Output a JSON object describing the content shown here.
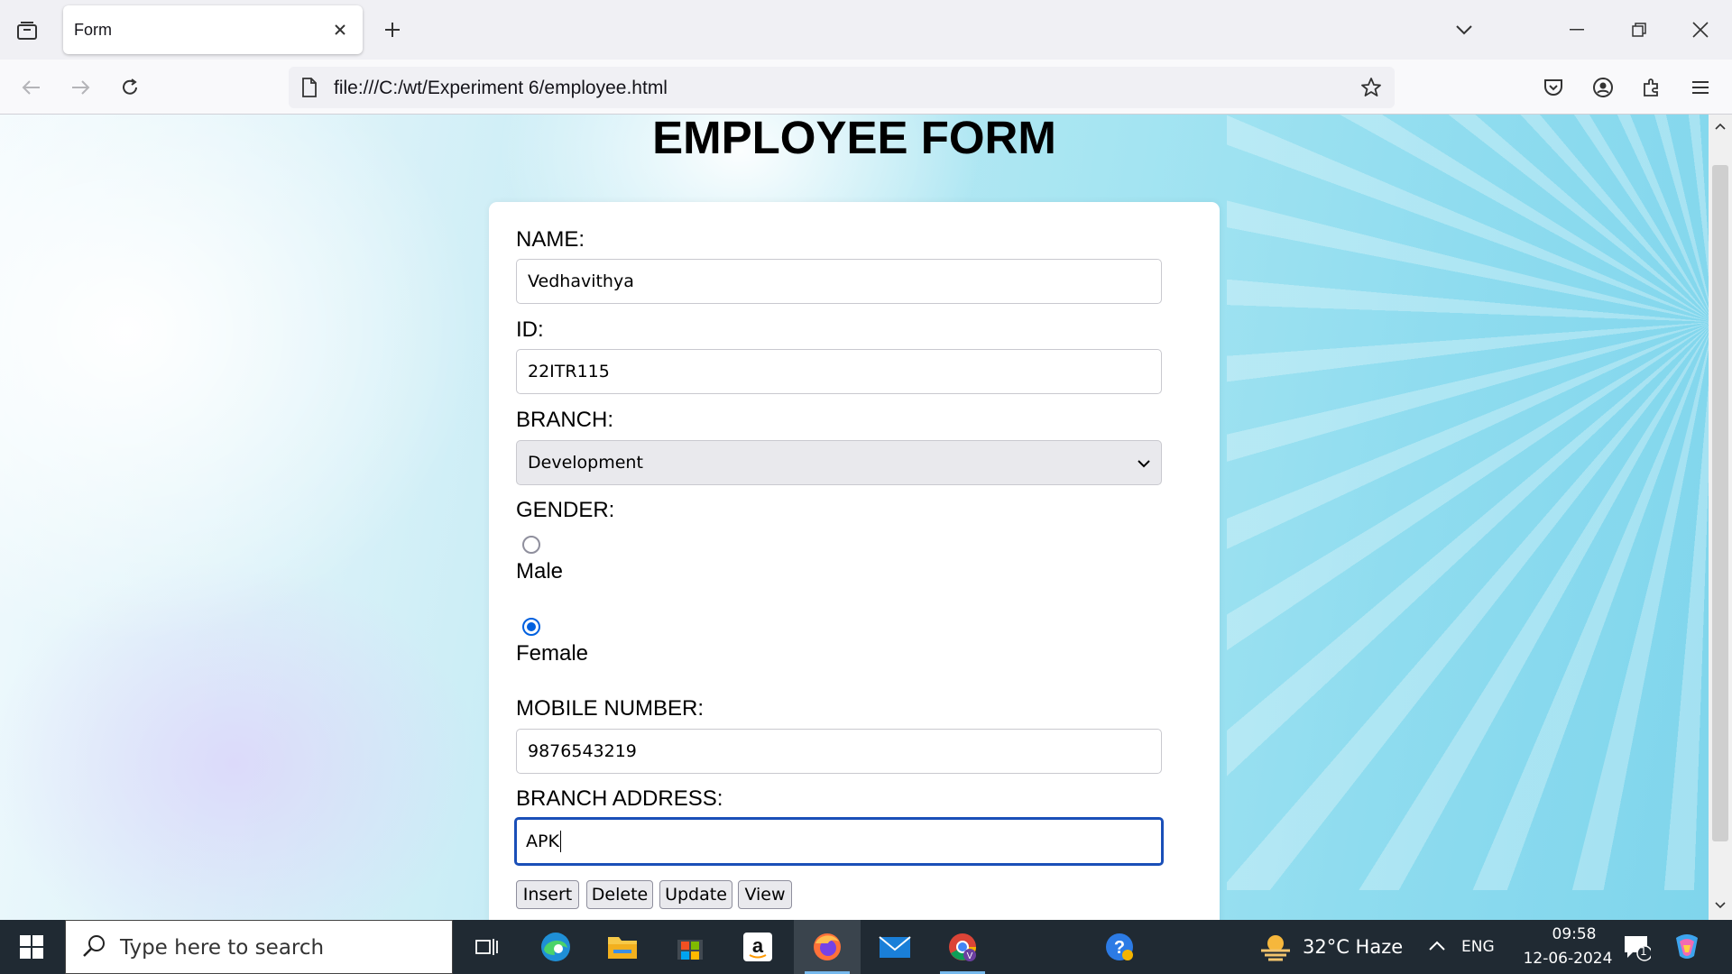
{
  "browser": {
    "tab_title": "Form",
    "url": "file:///C:/wt/Experiment 6/employee.html"
  },
  "page": {
    "title": "EMPLOYEE FORM",
    "form": {
      "name_label": "NAME:",
      "name_value": "Vedhavithya",
      "id_label": "ID:",
      "id_value": "22ITR115",
      "branch_label": "BRANCH:",
      "branch_value": "Development",
      "gender_label": "GENDER:",
      "gender_options": [
        {
          "label": "Male",
          "checked": false
        },
        {
          "label": "Female",
          "checked": true
        }
      ],
      "mobile_label": "MOBILE NUMBER:",
      "mobile_value": "9876543219",
      "address_label": "BRANCH ADDRESS:",
      "address_value": "APK",
      "buttons": {
        "insert": "Insert",
        "delete": "Delete",
        "update": "Update",
        "view": "View"
      }
    }
  },
  "taskbar": {
    "search_placeholder": "Type here to search",
    "weather": "32°C  Haze",
    "language": "ENG",
    "time": "09:58",
    "date": "12-06-2024",
    "notification_count": "1",
    "apps": [
      "task-view",
      "edge",
      "file-explorer",
      "microsoft-store",
      "amazon",
      "firefox",
      "mail",
      "chrome",
      "help"
    ]
  },
  "colors": {
    "focus_border": "#1a4fb8",
    "radio_checked": "#0060df",
    "taskbar_bg": "#202a33"
  }
}
